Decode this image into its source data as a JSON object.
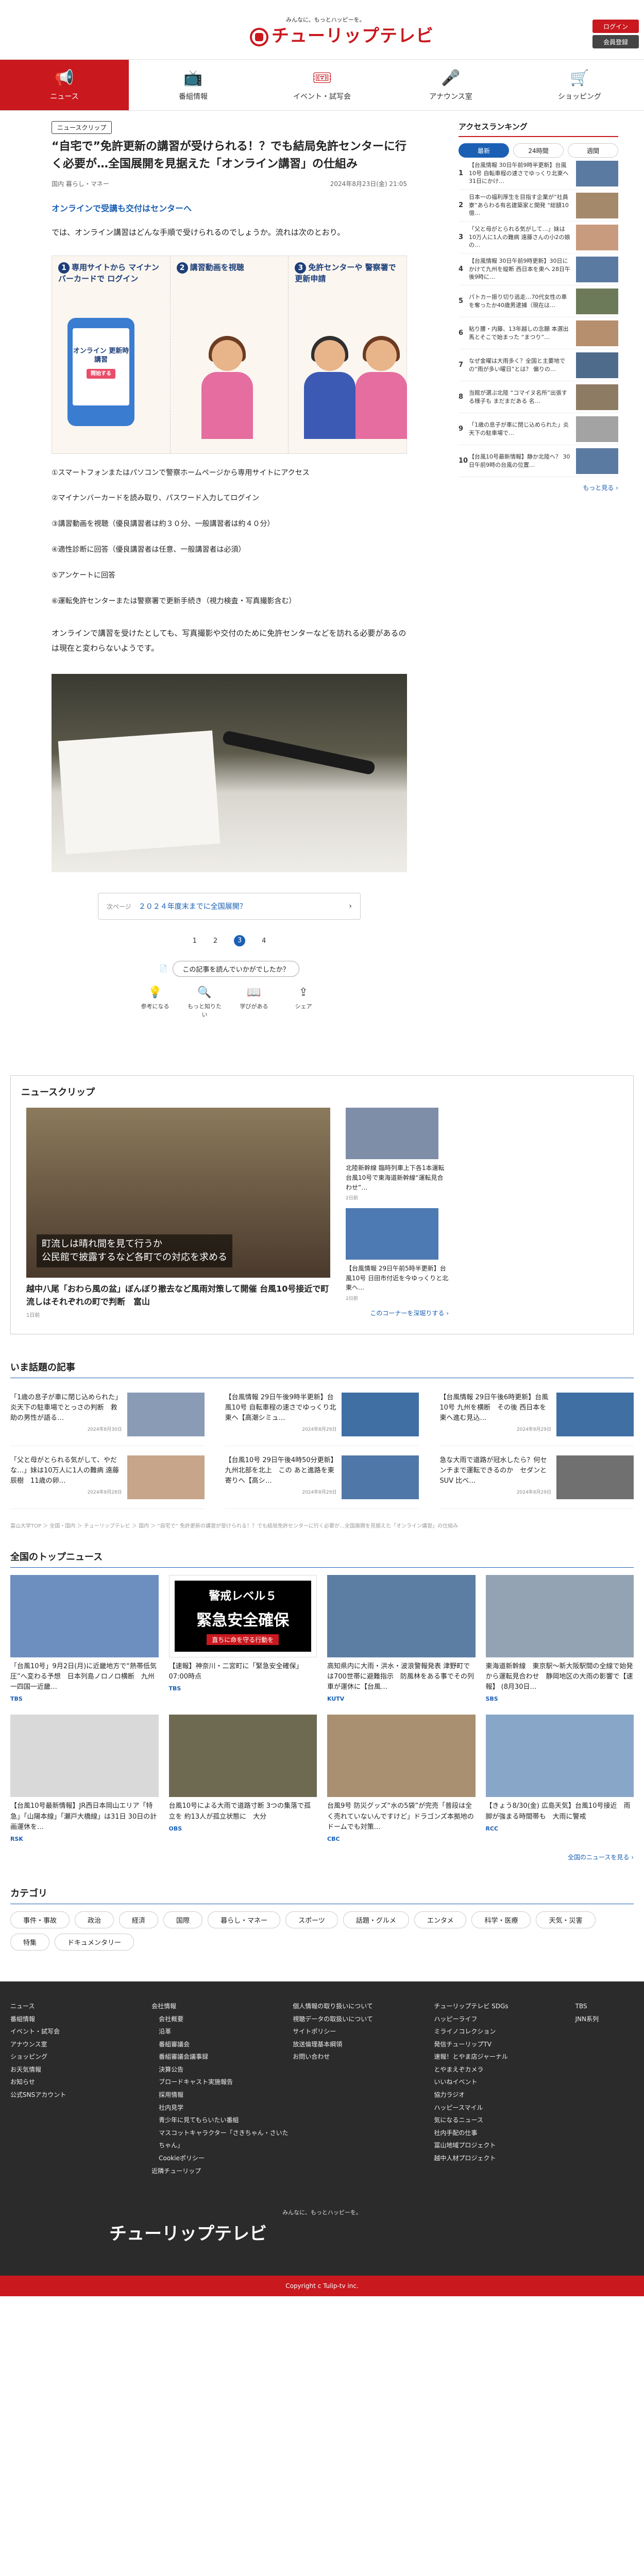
{
  "header": {
    "logo_tagline": "みんなに、もっとハッピーを。",
    "logo_text": "チューリップテレビ",
    "login_label": "ログイン",
    "member_label": "会員登録"
  },
  "nav": [
    {
      "label": "ニュース",
      "icon": "megaphone-icon",
      "active": true
    },
    {
      "label": "番組情報",
      "icon": "tv-icon",
      "active": false
    },
    {
      "label": "イベント・試写会",
      "icon": "ticket-icon",
      "active": false
    },
    {
      "label": "アナウンス室",
      "icon": "microphone-icon",
      "active": false
    },
    {
      "label": "ショッピング",
      "icon": "cart-icon",
      "active": false
    }
  ],
  "article": {
    "tag": "ニュースクリップ",
    "title": "“自宅で”免許更新の講習が受けられる！？でも結局免許センターに行く必要が…全国展開を見据えた「オンライン講習」の仕組み",
    "category": "国内 暮らし・マネー",
    "date": "2024年8月23日(金) 21:05",
    "lead_link": "オンラインで受講も交付はセンターへ",
    "para1": "では、オンライン講習はどんな手順で受けられるのでしょうか。流れは次のとおり。",
    "figure": {
      "step1": "専用サイトから マイナンバーカードで ログイン",
      "step2": "講習動画を視聴",
      "step3": "免許センターや 警察署で更新申請",
      "phone_text": "オンライン 更新時講習",
      "phone_btn": "開始する"
    },
    "steps": [
      "①スマートフォンまたはパソコンで警察ホームページから専用サイトにアクセス",
      "②マイナンバーカードを読み取り、パスワード入力してログイン",
      "③講習動画を視聴（優良講習者は約３０分、一般講習者は約４０分）",
      "④適性診断に回答（優良講習者は任意、一般講習者は必須）",
      "⑤アンケートに回答",
      "⑥運転免許センターまたは警察署で更新手続き（視力検査・写真撮影含む）"
    ],
    "para2": "オンラインで講習を受けたとしても、写真撮影や交付のために免許センターなどを訪れる必要があるのは現在と変わらないようです。",
    "next_label": "次ページ",
    "next_title": "２０２４年度末までに全国展開？",
    "pages": [
      "1",
      "2",
      "3",
      "4"
    ],
    "current_page": "3",
    "react_question": "この記事を読んでいかがでしたか？",
    "reactions": [
      {
        "label": "参考になる",
        "icon": "lightbulb-icon"
      },
      {
        "label": "もっと知りたい",
        "icon": "magnifier-icon"
      },
      {
        "label": "学びがある",
        "icon": "book-icon"
      },
      {
        "label": "シェア",
        "icon": "share-icon"
      }
    ]
  },
  "sidebar": {
    "title": "アクセスランキング",
    "tabs": [
      "最新",
      "24時間",
      "週間"
    ],
    "ranks": [
      {
        "n": "1",
        "t": "【台風情報 30日午前9時半更新】台風10号 自転車程の速さでゆっくり北東へ 31日にかけ…"
      },
      {
        "n": "2",
        "t": "日本一の福利厚生を目指す企業が“社員寮”あらわる有名建築家と開発 “総額10億…"
      },
      {
        "n": "3",
        "t": "「父と母がとられる気がして…」妹は10万人に1人の難病 遠藤さんの小2の娘の…"
      },
      {
        "n": "4",
        "t": "【台風情報 30日午前9時更新】30日にかけて九州を縦断 西日本を東へ 28日午後9時に…"
      },
      {
        "n": "5",
        "t": "パトカー振り切り逃走…70代女性の車を奪ったか40歳男逮捕（現在は…"
      },
      {
        "n": "6",
        "t": "粘り腰・内藤、13年越しの念願 本選出馬とそこで始まった “まつり”…"
      },
      {
        "n": "7",
        "t": "なぜ金曜は大雨多く？全国と主要地での“雨が多い曜日”とは？ 偏りの…"
      },
      {
        "n": "8",
        "t": "当館が選ぶ北陸 “コマイヌ名所”出張する様子も まだまだある 名…"
      },
      {
        "n": "9",
        "t": "「1歳の息子が車に閉じ込められた」炎天下の駐車場で…"
      },
      {
        "n": "10",
        "t": "【台風10号最新情報】静か北陸へ？ 30日午前9時の台風の位置…"
      }
    ],
    "more": "もっと見る ›"
  },
  "clip": {
    "title": "ニュースクリップ",
    "main_caption1": "町流しは晴れ間を見て行うか",
    "main_caption2": "公民館で披露するなど各町での対応を求める",
    "main_title": "越中八尾「おわら風の盆」ぼんぼり撤去など風雨対策して開催 台風10号接近で町流しはそれぞれの町で判断　富山",
    "main_time": "1日前",
    "subs": [
      {
        "t": "北陸新幹線 臨時列車上下各1本運転　台風10号で東海道新幹線“運転見合わせ”…",
        "m": "2日前"
      },
      {
        "t": "【台風情報 29日午前5時半更新】台風10号 日田市付近を今ゆっくりと北東へ…",
        "m": "2日前"
      }
    ],
    "more": "このコーナーを深堀りする ›"
  },
  "topics": {
    "title": "いま話題の記事",
    "items": [
      {
        "t": "「1歳の息子が車に閉じ込められた」炎天下の駐車場でとっさの判断　救助の男性が語る…",
        "m": "2024年8月30日"
      },
      {
        "t": "【台風情報 29日午後9時半更新】台風10号 自転車程の速さでゆっくり北東へ【高潮シミュ…",
        "m": "2024年8月29日"
      },
      {
        "t": "",
        "m": ""
      },
      {
        "t": "【台風情報 29日午後6時更新】台風10号 九州を横断　その後 西日本を東へ進む見込…",
        "m": "2024年8月29日"
      },
      {
        "t": "「父と母がとられる気がして、やだな…」妹は10万人に1人の難病 遠藤辰樹　11歳の卵…",
        "m": "2024年8月28日"
      },
      {
        "t": "",
        "m": ""
      },
      {
        "t": "【台風10号 29日午後4時50分更新】九州北部を北上　この あと進路を東寄りへ【高シ…",
        "m": "2024年8月29日"
      },
      {
        "t": "急な大雨で道路が冠水したら？何センチまで運転できるのか　セダンとSUV 比べ…",
        "m": "2024年8月29日"
      },
      {
        "t": "",
        "m": ""
      }
    ]
  },
  "breadcrumb": "富山大学TOP ＞ 全国・国内 ＞ チューリップテレビ ＞ 国内 ＞ “自宅で” 免許更新の講習が受けられる！？でも結局免許センターに行く必要が…全国展開を見据えた「オンライン講習」の仕組み",
  "tops": {
    "title": "全国のトップニュース",
    "items": [
      {
        "t": "「台風10号」9月2日(月)に近畿地方で“熱帯低気圧”へ変わる予想　日本列島ノロノロ横断　九州一四国一近畿…",
        "s": "TBS"
      },
      {
        "t": "【速報】神奈川・二宮町に「緊急安全確保」 07:00時点",
        "s": "TBS"
      },
      {
        "t": "高知県内に大雨・洪水・波浪警報発表 津野町では700世帯に避難指示　防風林をある事でその列車が運休に【台風…",
        "s": "KUTV"
      },
      {
        "t": "東海道新幹線　東京駅〜新大阪駅間の全線で始発から運転見合わせ　静岡地区の大雨の影響で【速報】 (8月30日…",
        "s": "SBS"
      },
      {
        "t": "【台風10号最新情報】JR西日本岡山エリア「特急」「山陽本線」「瀬戸大橋線」は31日 30日の計画運休を…",
        "s": "RSK"
      },
      {
        "t": "台風10号による大雨で道路寸断 3つの集落で孤立を 約13人が孤立状態に　大分",
        "s": "OBS"
      },
      {
        "t": "台風9号 防災グッズ“水の5袋”が完売「普段は全く売れていないんですけど」ドラゴンズ本拠地のドームでも対策…",
        "s": "CBC"
      },
      {
        "t": "【きょう8/30(金) 広島天気】台風10号接近　雨脚が強まる時間帯も　大雨に警戒",
        "s": "RCC"
      }
    ],
    "alert_small": "警戒レベル５",
    "alert_big": "緊急安全確保",
    "alert_note": "直ちに命を守る行動を",
    "more": "全国のニュースを見る ›"
  },
  "categories": {
    "title": "カテゴリ",
    "items": [
      "事件・事故",
      "政治",
      "経済",
      "国際",
      "暮らし・マネー",
      "スポーツ",
      "話題・グルメ",
      "エンタメ",
      "科学・医療",
      "天気・災害",
      "特集",
      "ドキュメンタリー"
    ]
  },
  "footer": {
    "col1": [
      "ニュース",
      "番組情報",
      "イベント・試写会",
      "アナウンス室",
      "ショッピング",
      "お天気情報",
      "お知らせ",
      "公式SNSアカウント"
    ],
    "col2": [
      "会社情報",
      "会社概要",
      "沿革",
      "番組審議会",
      "番組審議会議事録",
      "決算公告",
      "ブロードキャスト実施報告",
      "採用情報",
      "社内見学",
      "青少年に見てもらいたい番組",
      "マスコットキャラクター「さきちゃん・さいたちゃん」",
      "Cookieポリシー",
      "近隣チューリップ"
    ],
    "col3": [
      "個人情報の取り扱いについて",
      "視聴データの取扱いについて",
      "サイトポリシー",
      "放送倫理基本綱領",
      "お問い合わせ"
    ],
    "col4": [
      "チューリップテレビ SDGs",
      "ハッピーライフ",
      "ミライノコレクション",
      "発信チューリップTV",
      "速報！とやま店ジャーナル",
      "とやまえぞカメラ",
      "いいねイベント",
      "協力ラジオ",
      "ハッピースマイル",
      "気になるニュース",
      "社内手配の仕事",
      "冨山地域プロジェクト",
      "越中人材プロジェクト"
    ],
    "col5": [
      "TBS",
      "JNN系列"
    ],
    "logo_tagline": "みんなに、もっとハッピーを。",
    "logo_text": "チューリップテレビ",
    "copyright": "Copyright c Tulip-tv inc."
  },
  "colors": {
    "brand": "#c9181e",
    "link": "#1a5fb4",
    "footer_bg": "#2b2b2b"
  }
}
